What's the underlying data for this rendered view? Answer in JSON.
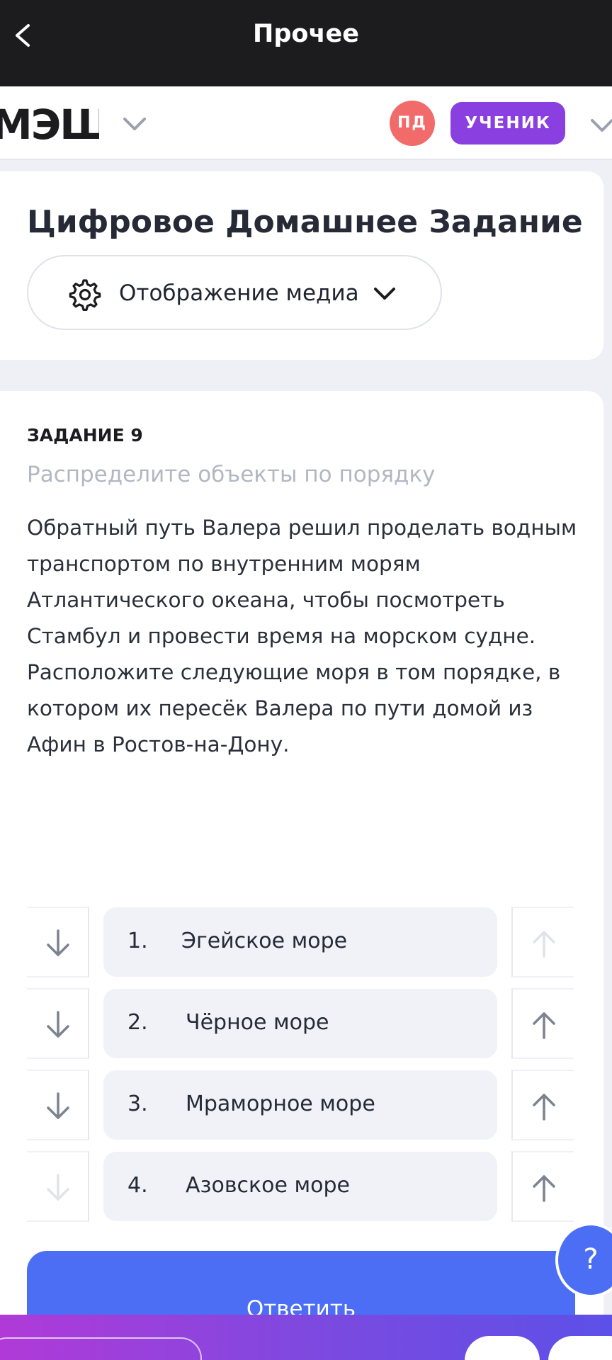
{
  "header": {
    "title": "Прочее",
    "back_icon": "chevron-left-icon"
  },
  "appbar": {
    "logo": "МЭШ",
    "avatar_initials": "ПД",
    "role": "УЧЕНИК",
    "avatar_color": "#f26b6b",
    "role_color": "#8a3fe0"
  },
  "assignment": {
    "title": "Цифровое Домашнее Задание",
    "media_button_label": "Отображение медиа"
  },
  "task": {
    "number": "ЗАДАНИЕ 9",
    "subtitle": "Распределите объекты по порядку",
    "text": "Обратный путь Валера решил проделать водным транспортом по внутренним морям Атлантического океана, чтобы посмотреть Стамбул и провести время на морском судне. Расположите следующие моря в том порядке, в котором их пересёк Валера по пути домой из Афин в Ростов-на-Дону.",
    "items": [
      {
        "num": "1.",
        "label": "Эгейское море"
      },
      {
        "num": "2.",
        "label": "Чёрное море"
      },
      {
        "num": "3.",
        "label": "Мраморное море"
      },
      {
        "num": "4.",
        "label": "Азовское море"
      }
    ]
  },
  "actions": {
    "submit_label": "Ответить",
    "help_label": "?"
  },
  "colors": {
    "accent": "#4c6ef5",
    "topbar": "#1c1c1e"
  }
}
